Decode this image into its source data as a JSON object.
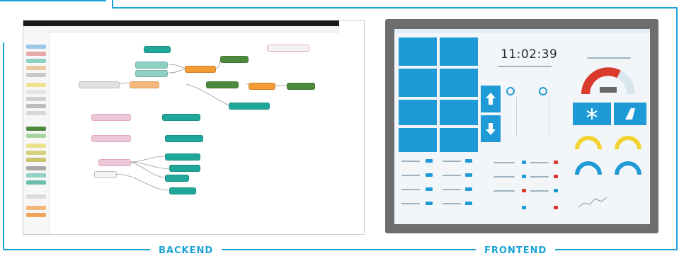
{
  "captions": {
    "backend": "BACKEND",
    "frontend": "FRONTEND"
  },
  "frontend": {
    "clock_time": "11:02:39"
  },
  "colors": {
    "accent": "#1aa3d6",
    "tile_blue": "#1e9bd7",
    "node_teal": "#1fa79a",
    "node_orange": "#f39c34",
    "node_green": "#4e8a3e",
    "node_pink": "#e8a3c0",
    "node_gray": "#c0c0c0",
    "gauge_red": "#d93a2b"
  },
  "icons": {
    "nav_up": "arrow-up-icon",
    "nav_down": "arrow-down-icon",
    "snowflake": "snowflake-icon",
    "shower": "shower-icon"
  }
}
